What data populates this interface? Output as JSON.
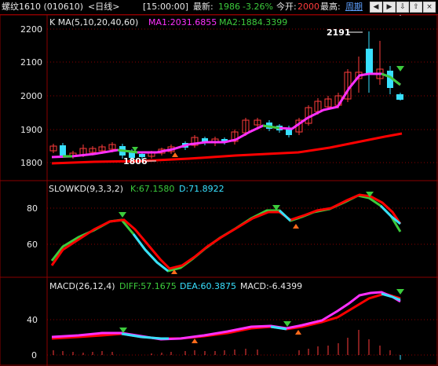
{
  "header": {
    "symbol": "螺纹1610 (010610)",
    "period": "<日线>",
    "time": "[15:00:00]",
    "latest_label": "最新:",
    "latest_value": "1986",
    "change_pct": "-3.26%",
    "open_label": "今开:",
    "open_value": "2000",
    "high_label": "最高:",
    "cycle_label": "周期",
    "nav_buttons": [
      "prev",
      "next",
      "zoom-out",
      "zoom-in",
      "close"
    ]
  },
  "main_panel": {
    "title": "K  MA(5,10,20,40,60)",
    "ma1": "MA1:2031.6855",
    "ma2": "MA2:1884.3399",
    "y_ticks": [
      "2200",
      "2100",
      "2000",
      "1900",
      "1800"
    ],
    "max_label": "2191",
    "min_label": "1806"
  },
  "kd_panel": {
    "title": "SLOWKD(9,3,3,2)",
    "k": "K:67.1580",
    "d": "D:71.8922",
    "y_ticks": [
      "80",
      "60"
    ]
  },
  "macd_panel": {
    "title": "MACD(26,12,4)",
    "diff": "DIFF:57.1675",
    "dea": "DEA:60.3875",
    "macd": "MACD:-6.4399",
    "y_ticks": [
      "40",
      "0"
    ]
  },
  "colors": {
    "grid": "#8a0000",
    "up": "#ff3b3b",
    "down": "#38e0ff",
    "ma1": "#ff30ff",
    "ma2": "#ff0000",
    "signal_green": "#3ccb3c"
  }
}
